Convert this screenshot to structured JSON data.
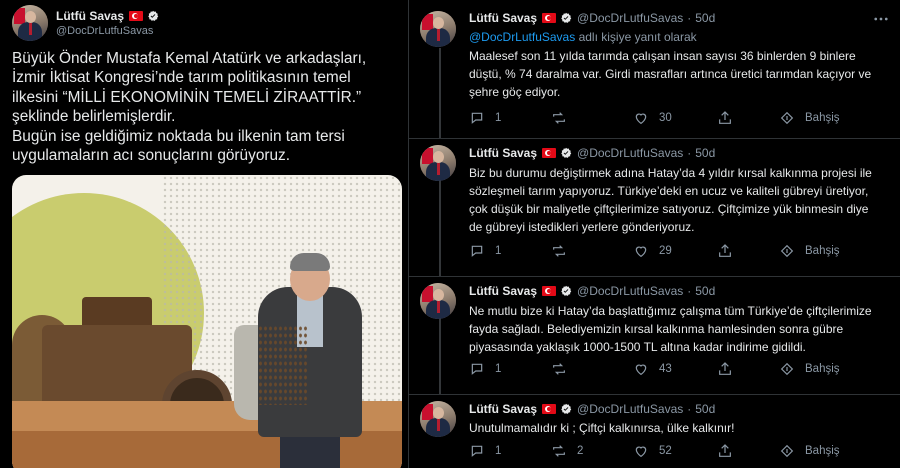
{
  "main_tweet": {
    "author_name": "Lütfü Savaş",
    "author_handle": "@DocDrLutfuSavas",
    "text": "Büyük Önder Mustafa Kemal Atatürk ve arkadaşları,\nİzmir İktisat Kongresi’nde tarım politikasının temel\nilkesini “MİLLİ EKONOMİNİN TEMELİ ZİRAATTİR.”\nşeklinde belirlemişlerdir.\nBugün ise geldiğimiz noktada bu ilkenin tam tersi\nuygulamaların acı sonuçlarını görüyoruz."
  },
  "replies": [
    {
      "author_name": "Lütfü Savaş",
      "author_handle": "@DocDrLutfuSavas",
      "time": "50d",
      "reply_mention": "@DocDrLutfuSavas",
      "reply_suffix": " adlı kişiye yanıt olarak",
      "text": "Maalesef son 11 yılda tarımda çalışan insan sayısı 36 binlerden 9 binlere\ndüştü, % 74 daralma var. Girdi masrafları artınca üretici tarımdan kaçıyor ve\nşehre göç ediyor.",
      "replies_count": "1",
      "retweets_count": "",
      "likes_count": "30",
      "tip_label": "Bahşiş"
    },
    {
      "author_name": "Lütfü Savaş",
      "author_handle": "@DocDrLutfuSavas",
      "time": "50d",
      "text": "Biz bu durumu değiştirmek adına Hatay’da 4 yıldır kırsal kalkınma projesi ile\nsözleşmeli tarım yapıyoruz. Türkiye’deki en ucuz ve kaliteli gübreyi üretiyor,\nçok düşük bir maliyetle çiftçilerimize satıyoruz. Çiftçimize yük binmesin diye\nde gübreyi istedikleri yerlere gönderiyoruz.",
      "replies_count": "1",
      "retweets_count": "",
      "likes_count": "29",
      "tip_label": "Bahşiş"
    },
    {
      "author_name": "Lütfü Savaş",
      "author_handle": "@DocDrLutfuSavas",
      "time": "50d",
      "text": "Ne mutlu bize ki Hatay’da başlattığımız çalışma tüm Türkiye’de çiftçilerimize\nfayda sağladı. Belediyemizin kırsal kalkınma hamlesinden sonra gübre\npiyasasında yaklaşık 1000-1500 TL altına kadar indirime gidildi.",
      "replies_count": "1",
      "retweets_count": "",
      "likes_count": "43",
      "tip_label": "Bahşiş"
    },
    {
      "author_name": "Lütfü Savaş",
      "author_handle": "@DocDrLutfuSavas",
      "time": "50d",
      "text": "Unutulmamalıdır ki ; Çiftçi kalkınırsa, ülke kalkınır!",
      "replies_count": "1",
      "retweets_count": "2",
      "likes_count": "52",
      "tip_label": "Bahşiş"
    }
  ],
  "icons": {
    "flag": "turkey-flag-icon",
    "verified": "verified-badge-icon",
    "reply": "reply-icon",
    "retweet": "retweet-icon",
    "like": "heart-icon",
    "share": "share-icon",
    "tip": "tip-icon",
    "more": "more-icon"
  },
  "colors": {
    "background": "#000000",
    "text": "#e7e9ea",
    "muted": "#8b98a5",
    "link": "#1d9bf0",
    "divider": "#2f3336"
  }
}
